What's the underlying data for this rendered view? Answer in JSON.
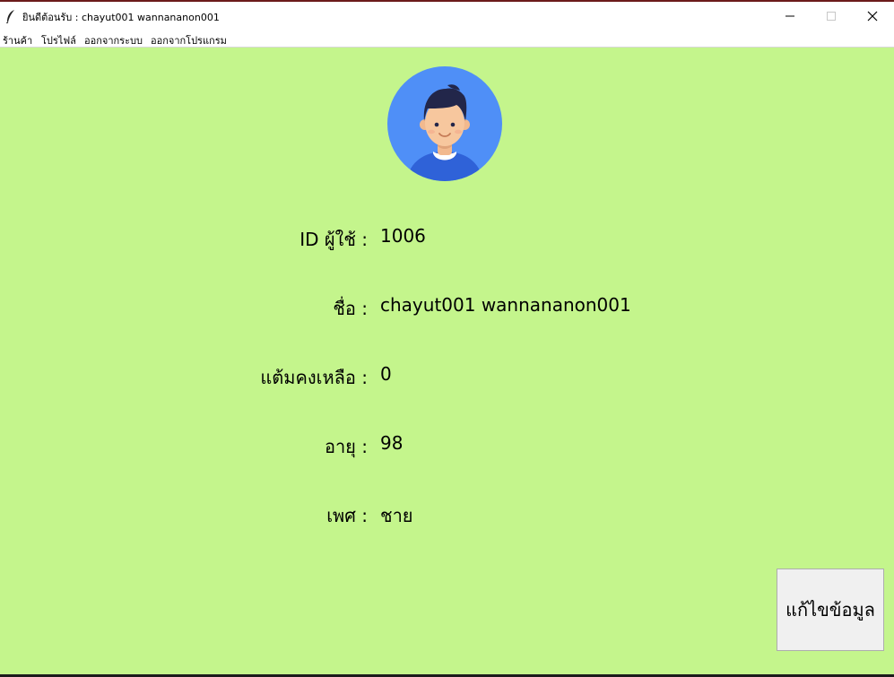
{
  "window": {
    "title": "ยินดีต้อนรับ : chayut001 wannananon001",
    "controls": {
      "minimize_icon": "minimize-icon",
      "maximize_icon": "maximize-icon",
      "close_icon": "close-icon"
    }
  },
  "menu": {
    "items": [
      {
        "label": "ร้านค้า"
      },
      {
        "label": "โปรไฟล์"
      },
      {
        "label": "ออกจากระบบ"
      },
      {
        "label": "ออกจากโปรแกรม"
      }
    ]
  },
  "profile": {
    "avatar_icon": "user-avatar-icon",
    "fields": [
      {
        "label": "ID ผู้ใช้ :",
        "value": "1006"
      },
      {
        "label": "ชื่อ :",
        "value": "chayut001 wannananon001"
      },
      {
        "label": "แต้มคงเหลือ :",
        "value": "0"
      },
      {
        "label": "อายุ :",
        "value": "98"
      },
      {
        "label": "เพศ :",
        "value": "ชาย"
      }
    ]
  },
  "actions": {
    "edit_label": "แก้ไขข้อมูล"
  },
  "colors": {
    "background": "#c4f58c",
    "avatar_circle": "#4f8ff7",
    "button_face": "#f0f0f0"
  }
}
